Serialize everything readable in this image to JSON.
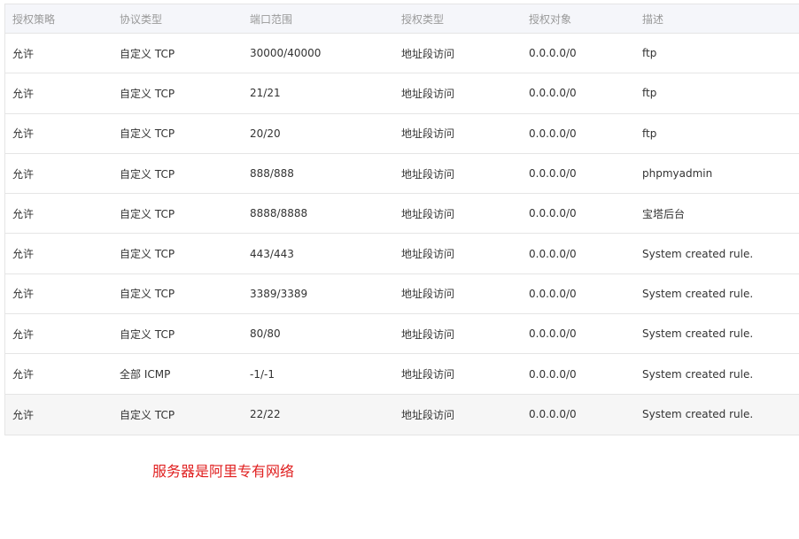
{
  "table": {
    "headers": [
      "授权策略",
      "协议类型",
      "端口范围",
      "授权类型",
      "授权对象",
      "描述"
    ],
    "rows": [
      [
        "允许",
        "自定义 TCP",
        "30000/40000",
        "地址段访问",
        "0.0.0.0/0",
        "ftp"
      ],
      [
        "允许",
        "自定义 TCP",
        "21/21",
        "地址段访问",
        "0.0.0.0/0",
        "ftp"
      ],
      [
        "允许",
        "自定义 TCP",
        "20/20",
        "地址段访问",
        "0.0.0.0/0",
        "ftp"
      ],
      [
        "允许",
        "自定义 TCP",
        "888/888",
        "地址段访问",
        "0.0.0.0/0",
        "phpmyadmin"
      ],
      [
        "允许",
        "自定义 TCP",
        "8888/8888",
        "地址段访问",
        "0.0.0.0/0",
        "宝塔后台"
      ],
      [
        "允许",
        "自定义 TCP",
        "443/443",
        "地址段访问",
        "0.0.0.0/0",
        "System created rule."
      ],
      [
        "允许",
        "自定义 TCP",
        "3389/3389",
        "地址段访问",
        "0.0.0.0/0",
        "System created rule."
      ],
      [
        "允许",
        "自定义 TCP",
        "80/80",
        "地址段访问",
        "0.0.0.0/0",
        "System created rule."
      ],
      [
        "允许",
        "全部 ICMP",
        "-1/-1",
        "地址段访问",
        "0.0.0.0/0",
        "System created rule."
      ],
      [
        "允许",
        "自定义 TCP",
        "22/22",
        "地址段访问",
        "0.0.0.0/0",
        "System created rule."
      ]
    ]
  },
  "note": "服务器是阿里专有网络",
  "colors": {
    "header_bg": "#f5f6fa",
    "header_text": "#999999",
    "border": "#e5e5e5",
    "note_text": "#e02020"
  }
}
